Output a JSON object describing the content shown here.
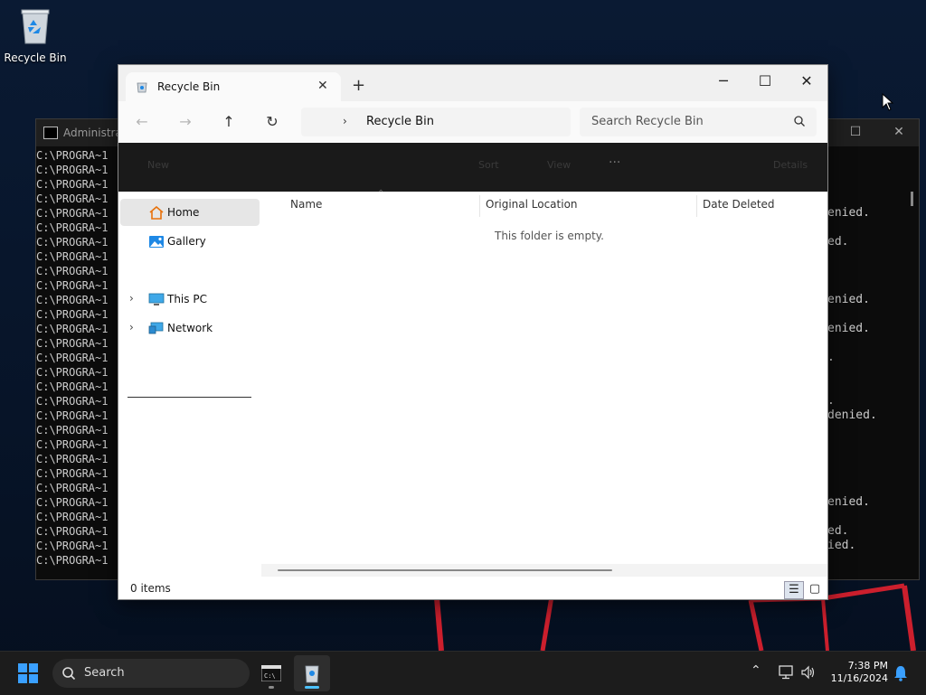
{
  "desktop": {
    "recycle_bin_label": "Recycle Bin"
  },
  "cmd_window": {
    "title": "Administrat",
    "left_lines": [
      "C:\\PROGRA~1",
      "C:\\PROGRA~1",
      "C:\\PROGRA~1",
      "C:\\PROGRA~1",
      "C:\\PROGRA~1",
      "C:\\PROGRA~1",
      "C:\\PROGRA~1",
      "C:\\PROGRA~1",
      "C:\\PROGRA~1",
      "C:\\PROGRA~1",
      "C:\\PROGRA~1",
      "C:\\PROGRA~1",
      "C:\\PROGRA~1",
      "C:\\PROGRA~1",
      "C:\\PROGRA~1",
      "C:\\PROGRA~1",
      "C:\\PROGRA~1",
      "C:\\PROGRA~1",
      "C:\\PROGRA~1",
      "C:\\PROGRA~1",
      "C:\\PROGRA~1",
      "C:\\PROGRA~1",
      "C:\\PROGRA~1",
      "C:\\PROGRA~1",
      "C:\\PROGRA~1",
      "C:\\PROGRA~1",
      "C:\\PROGRA~1",
      "C:\\PROGRA~1",
      "C:\\PROGRA~1"
    ],
    "right_lines": [
      "",
      "",
      "",
      "",
      "enied.",
      "",
      "ed.",
      "",
      "",
      "",
      "enied.",
      "",
      "enied.",
      "",
      ".",
      "",
      "",
      ".",
      "denied.",
      "",
      "",
      "",
      "",
      "",
      "enied.",
      "",
      "ed.",
      "ied.",
      ""
    ]
  },
  "explorer": {
    "tab_title": "Recycle Bin",
    "breadcrumb": "Recycle Bin",
    "search_placeholder": "Search Recycle Bin",
    "commandbar": {
      "new_label": "New",
      "sort_label": "Sort",
      "view_label": "View",
      "more_label": "···",
      "details_label": "Details"
    },
    "nav": {
      "home": "Home",
      "gallery": "Gallery",
      "this_pc": "This PC",
      "network": "Network"
    },
    "columns": [
      "Name",
      "Original Location",
      "Date Deleted"
    ],
    "empty_message": "This folder is empty.",
    "status_count": "0 items"
  },
  "taskbar": {
    "search_label": "Search",
    "time": "7:38 PM",
    "date": "11/16/2024"
  },
  "colors": {
    "accent": "#0078d4",
    "taskbar_bg": "#1c1c1c",
    "desktop_bg": "#0a1a33",
    "red_lines": "#cc1f2d"
  }
}
